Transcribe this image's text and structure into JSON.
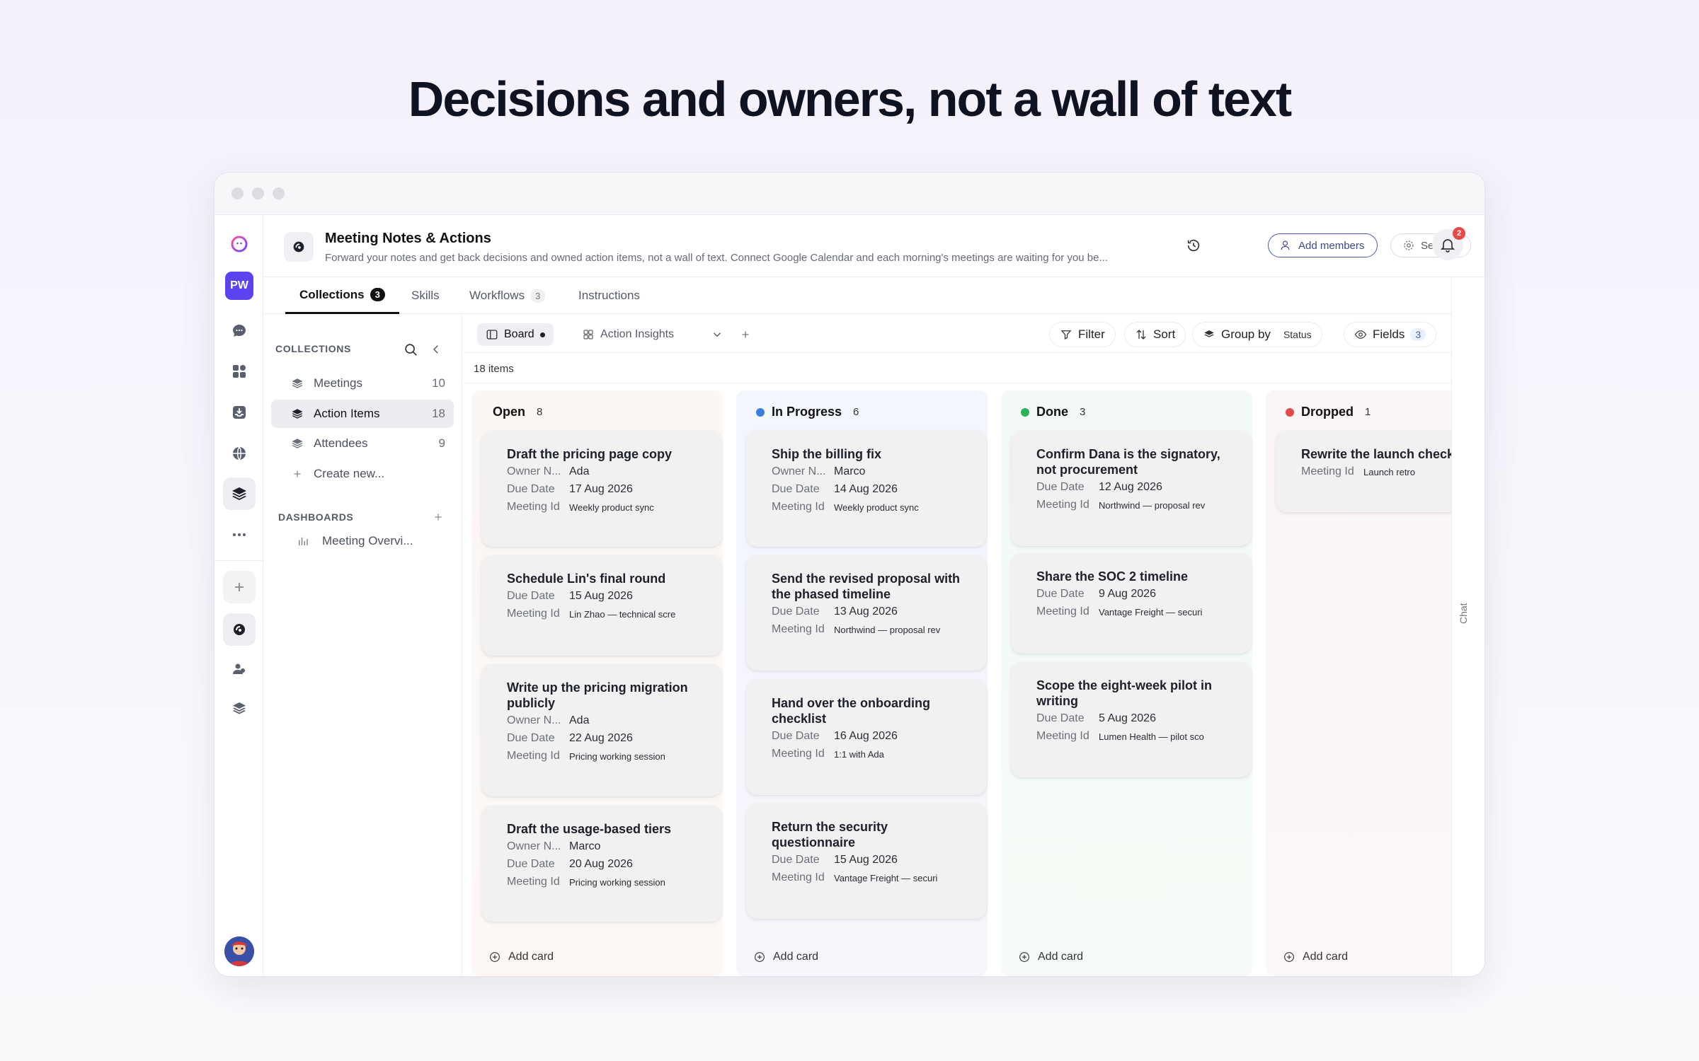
{
  "headline": "Decisions and owners, not a wall of text",
  "app": {
    "title": "Meeting Notes & Actions",
    "description": "Forward your notes and get back decisions and owned action items, not a wall of text. Connect Google Calendar and each morning's meetings are waiting for you be...",
    "add_members": "Add members",
    "settings": "Settings",
    "notifications": "2"
  },
  "rail": {
    "workspace_initials": "PW"
  },
  "tabs": [
    {
      "label": "Collections",
      "count": "3"
    },
    {
      "label": "Skills",
      "count": ""
    },
    {
      "label": "Workflows",
      "count": "3"
    },
    {
      "label": "Instructions",
      "count": ""
    }
  ],
  "sidebar": {
    "collections_heading": "COLLECTIONS",
    "items": [
      {
        "label": "Meetings",
        "count": "10"
      },
      {
        "label": "Action Items",
        "count": "18"
      },
      {
        "label": "Attendees",
        "count": "9"
      }
    ],
    "create_new": "Create new...",
    "dashboards_heading": "DASHBOARDS",
    "dashboard_item": "Meeting Overvi..."
  },
  "toolbar": {
    "board": "Board",
    "action_insights": "Action Insights",
    "filter": "Filter",
    "sort": "Sort",
    "group_by": "Group by",
    "group_by_value": "Status",
    "fields": "Fields",
    "fields_count": "3"
  },
  "item_count": "18 items",
  "chat": "Chat",
  "add_card": "Add card",
  "columns": [
    {
      "name": "Open",
      "count": "8",
      "color": "",
      "cards": [
        {
          "title": "Draft the pricing page copy",
          "owner": "Ada",
          "due": "17 Aug 2026",
          "meeting": "Weekly product sync"
        },
        {
          "title": "Schedule Lin's final round",
          "owner": "",
          "due": "15 Aug 2026",
          "meeting": "Lin Zhao — technical scre"
        },
        {
          "title": "Write up the pricing migration publicly",
          "owner": "Ada",
          "due": "22 Aug 2026",
          "meeting": "Pricing working session"
        },
        {
          "title": "Draft the usage-based tiers",
          "owner": "Marco",
          "due": "20 Aug 2026",
          "meeting": "Pricing working session"
        }
      ]
    },
    {
      "name": "In Progress",
      "count": "6",
      "color": "#3b7ddd",
      "cards": [
        {
          "title": "Ship the billing fix",
          "owner": "Marco",
          "due": "14 Aug 2026",
          "meeting": "Weekly product sync"
        },
        {
          "title": "Send the revised proposal with the phased timeline",
          "owner": "",
          "due": "13 Aug 2026",
          "meeting": "Northwind — proposal rev"
        },
        {
          "title": "Hand over the onboarding checklist",
          "owner": "",
          "due": "16 Aug 2026",
          "meeting": "1:1 with Ada"
        },
        {
          "title": "Return the security questionnaire",
          "owner": "",
          "due": "15 Aug 2026",
          "meeting": "Vantage Freight — securi"
        }
      ]
    },
    {
      "name": "Done",
      "count": "3",
      "color": "#2fb35a",
      "cards": [
        {
          "title": "Confirm Dana is the signatory, not procurement",
          "owner": "",
          "due": "12 Aug 2026",
          "meeting": "Northwind — proposal rev"
        },
        {
          "title": "Share the SOC 2 timeline",
          "owner": "",
          "due": "9 Aug 2026",
          "meeting": "Vantage Freight — securi"
        },
        {
          "title": "Scope the eight-week pilot in writing",
          "owner": "",
          "due": "5 Aug 2026",
          "meeting": "Lumen Health — pilot sco"
        }
      ]
    },
    {
      "name": "Dropped",
      "count": "1",
      "color": "#e54848",
      "cards": [
        {
          "title": "Rewrite the launch checkl",
          "owner": "",
          "due": "",
          "meeting": "Launch retro"
        }
      ]
    }
  ],
  "field_labels": {
    "owner": "Owner N...",
    "due": "Due Date",
    "meeting": "Meeting Id"
  }
}
